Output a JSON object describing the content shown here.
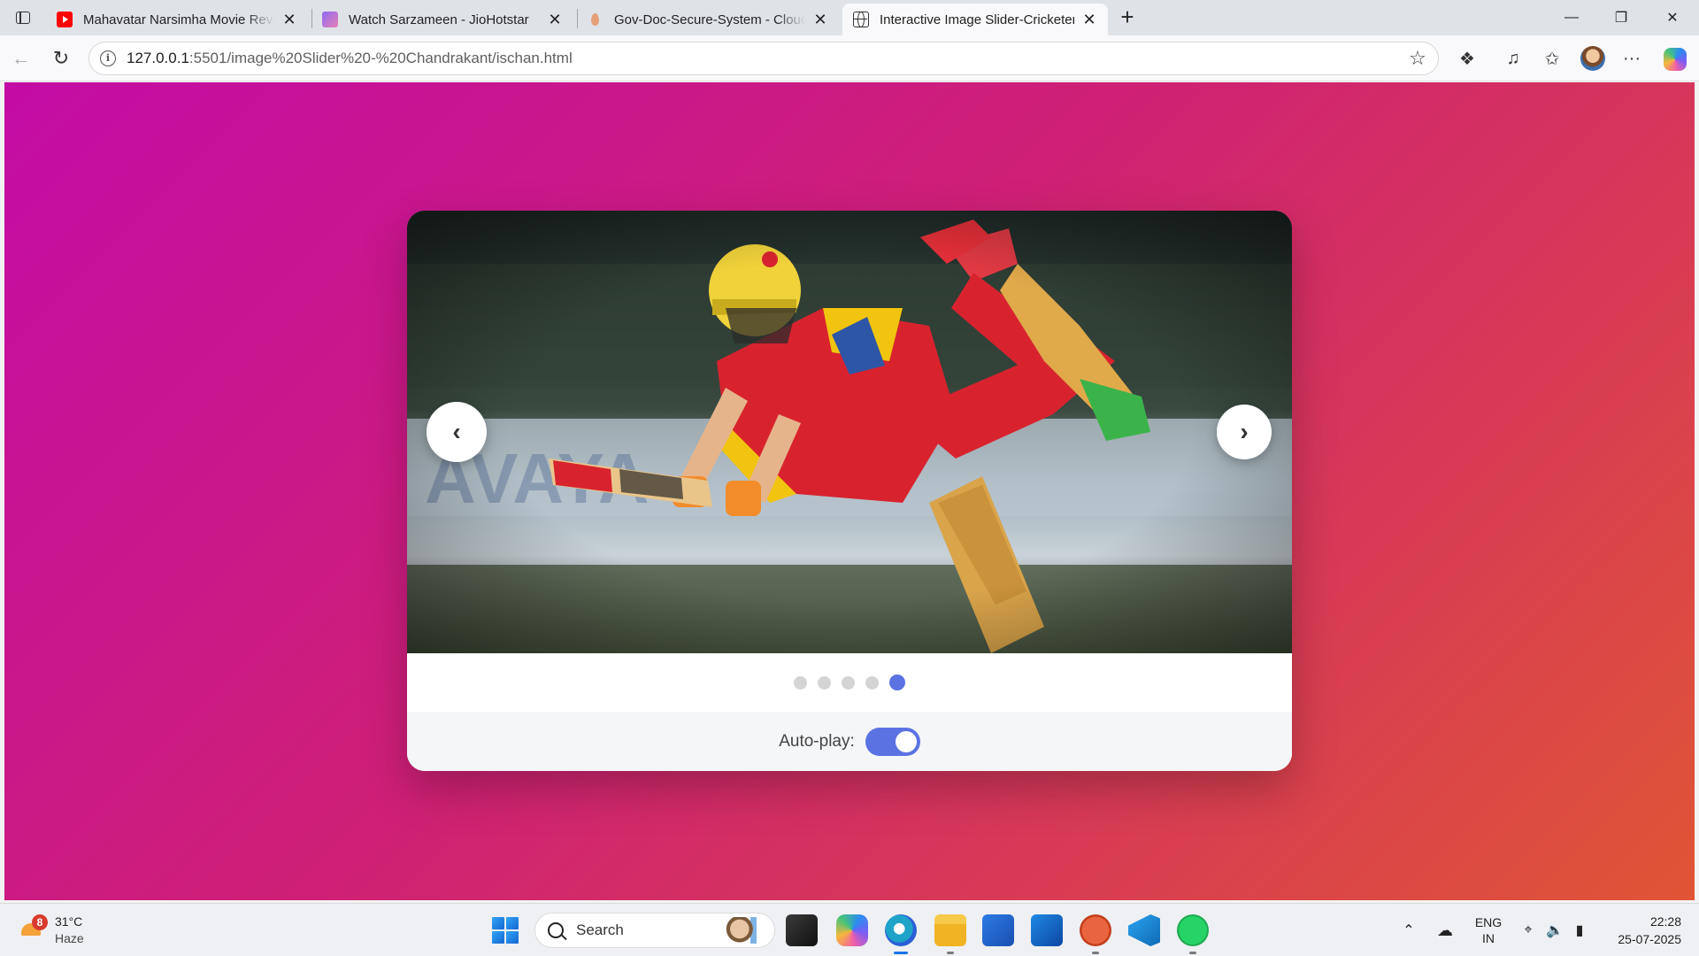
{
  "browser": {
    "tabs": [
      {
        "title": "Mahavatar Narsimha Movie Revie",
        "icon": "youtube-icon",
        "active": false
      },
      {
        "title": "Watch Sarzameen - JioHotstar",
        "icon": "jiohotstar-icon",
        "active": false
      },
      {
        "title": "Gov-Doc-Secure-System - Cloud I",
        "icon": "cloud-icon",
        "active": false
      },
      {
        "title": "Interactive Image Slider-Cricketer",
        "icon": "globe-icon",
        "active": true
      }
    ],
    "close_glyph": "✕",
    "new_tab_glyph": "+",
    "window_controls": {
      "minimize": "—",
      "restore": "❐",
      "close": "✕"
    },
    "address": {
      "host": "127.0.0.1",
      "rest": ":5501/image%20Slider%20-%20Chandrakant/ischan.html"
    }
  },
  "slider": {
    "image_subject": "cricketer-batting",
    "prev_glyph": "‹",
    "next_glyph": "›",
    "dot_count": 5,
    "active_dot": 5,
    "autoplay_label": "Auto-play:",
    "autoplay_on": true,
    "accent": "#5b72e3"
  },
  "taskbar": {
    "weather": {
      "temp": "31°C",
      "condition": "Haze",
      "badge": "8"
    },
    "search_label": "Search",
    "tray": {
      "lang_top": "ENG",
      "lang_bottom": "IN"
    },
    "clock": {
      "time": "22:28",
      "date": "25-07-2025"
    }
  },
  "colors": {
    "gradient_start": "#c40ca6",
    "gradient_mid": "#cf2075",
    "gradient_end": "#e05535"
  }
}
